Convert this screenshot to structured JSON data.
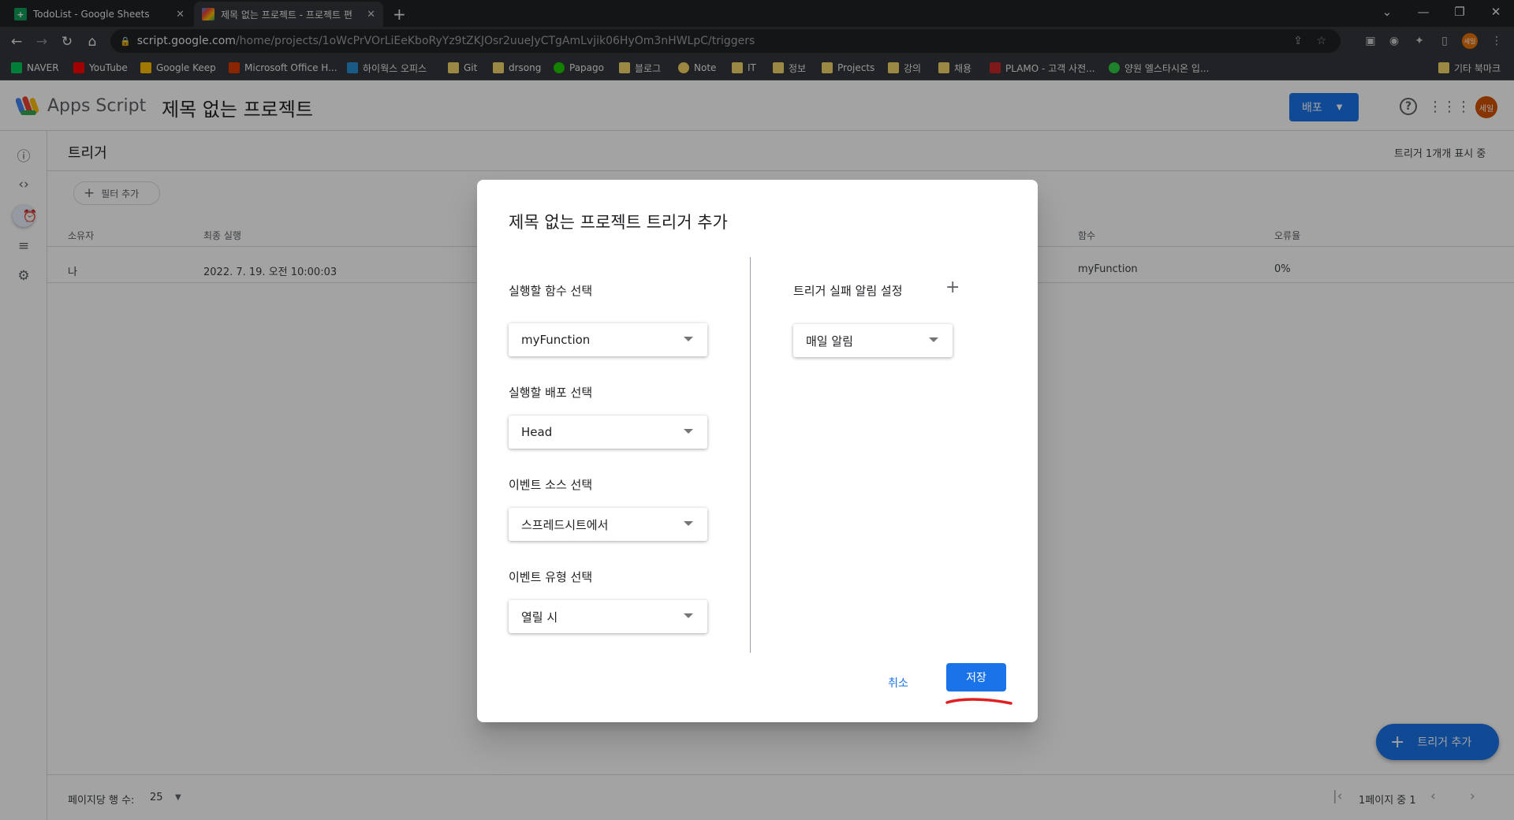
{
  "browser": {
    "tabs": [
      {
        "title": "TodoList - Google Sheets",
        "active": false
      },
      {
        "title": "제목 없는 프로젝트 - 프로젝트 편",
        "active": true
      }
    ],
    "new_tab": "+",
    "url_host": "script.google.com",
    "url_path": "/home/projects/1oWcPrVOrLiEeKboRyYz9tZKJOsr2uueJyCTgAmLvjik06HyOm3nHWLpC/triggers",
    "bookmarks": [
      "NAVER",
      "YouTube",
      "Google Keep",
      "Microsoft Office H...",
      "하이웍스 오피스",
      "Git",
      "drsong",
      "Papago",
      "블로그",
      "Note",
      "IT",
      "정보",
      "Projects",
      "강의",
      "채용",
      "PLAMO - 고객 사전...",
      "양원 엘스타시온 입...",
      "기타 북마크"
    ]
  },
  "app": {
    "name": "Apps Script",
    "project_title": "제목 없는 프로젝트",
    "deploy_label": "배포",
    "avatar_text": "세일",
    "page_title": "트리거",
    "showing_count": "트리거 1개개 표시 중",
    "filter_label": "필터 추가",
    "table": {
      "headers": [
        "소유자",
        "최종 실행",
        "함수",
        "오류율"
      ],
      "rows": [
        [
          "나",
          "2022. 7. 19. 오전 10:00:03",
          "myFunction",
          "0%"
        ]
      ]
    },
    "add_trigger_fab": "트리거 추가",
    "pagination": {
      "rows_per_page_label": "페이지당 행 수:",
      "rows_per_page": "25",
      "page_info": "1페이지 중 1"
    }
  },
  "dialog": {
    "title": "제목 없는 프로젝트 트리거 추가",
    "fields": [
      {
        "label": "실행할 함수 선택",
        "value": "myFunction"
      },
      {
        "label": "실행할 배포 선택",
        "value": "Head"
      },
      {
        "label": "이벤트 소스 선택",
        "value": "스프레드시트에서"
      },
      {
        "label": "이벤트 유형 선택",
        "value": "열릴 시"
      }
    ],
    "notification_label": "트리거 실패 알림 설정",
    "notification_value": "매일 알림",
    "cancel_label": "취소",
    "save_label": "저장"
  },
  "colors": {
    "accent": "#1a73e8",
    "annotation": "#e02020"
  }
}
